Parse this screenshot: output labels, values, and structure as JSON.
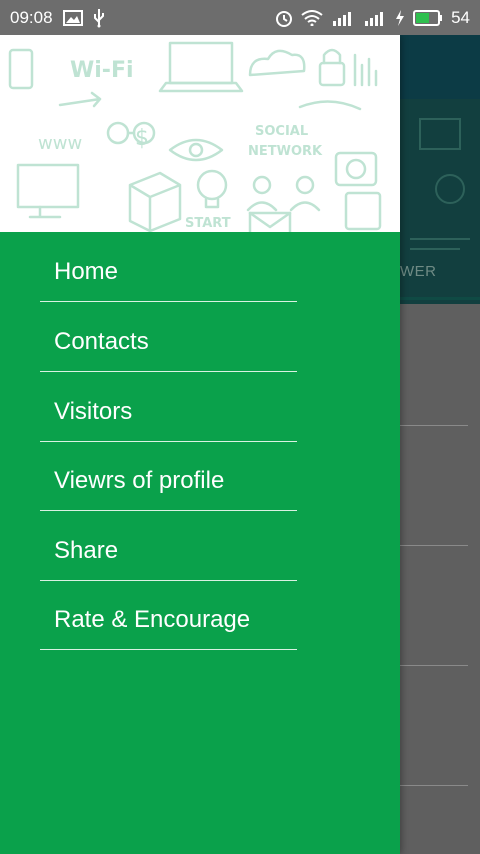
{
  "status_bar": {
    "time": "09:08",
    "battery_level": "54",
    "left_icons": [
      "image-icon",
      "usb-icon"
    ],
    "right_icons": [
      "alarm-icon",
      "wifi-icon",
      "signal-3g-icon",
      "signal-icon",
      "charging-icon",
      "battery-icon"
    ]
  },
  "background_app": {
    "tab_label": "WER"
  },
  "drawer": {
    "header_image": "tech-doodle-illustration",
    "menu": [
      {
        "label": "Home"
      },
      {
        "label": "Contacts"
      },
      {
        "label": "Visitors"
      },
      {
        "label": "Viewrs of profile"
      },
      {
        "label": "Share"
      },
      {
        "label": "Rate & Encourage"
      }
    ]
  },
  "colors": {
    "drawer_green": "#0aa14b",
    "status_bar": "#6d6d6d",
    "scrim": "#5f5f5f",
    "toolbar": "#0c3b45",
    "doodle": "#bfe3d3"
  }
}
